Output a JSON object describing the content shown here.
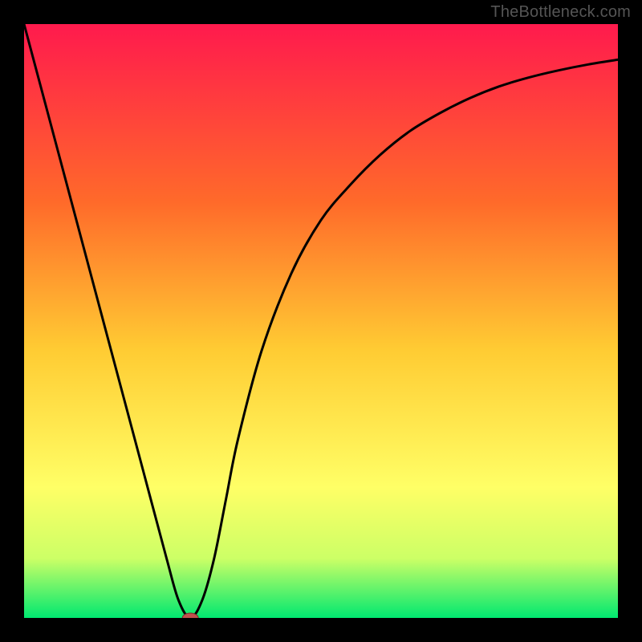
{
  "watermark": "TheBottleneck.com",
  "chart_data": {
    "type": "line",
    "title": "",
    "xlabel": "",
    "ylabel": "",
    "xlim": [
      0,
      100
    ],
    "ylim": [
      0,
      100
    ],
    "grid": false,
    "legend": false,
    "background_gradient": {
      "stops": [
        {
          "offset": 0,
          "color": "#ff1a4d"
        },
        {
          "offset": 30,
          "color": "#ff6a2a"
        },
        {
          "offset": 55,
          "color": "#ffcc33"
        },
        {
          "offset": 78,
          "color": "#ffff66"
        },
        {
          "offset": 90,
          "color": "#ccff66"
        },
        {
          "offset": 100,
          "color": "#00e870"
        }
      ]
    },
    "series": [
      {
        "name": "bottleneck-curve",
        "x": [
          0,
          4,
          8,
          12,
          16,
          20,
          24,
          26,
          28,
          30,
          32,
          34,
          36,
          40,
          45,
          50,
          55,
          60,
          65,
          70,
          75,
          80,
          85,
          90,
          95,
          100
        ],
        "y": [
          100,
          85,
          70,
          55,
          40,
          25,
          10,
          3,
          0,
          3,
          10,
          20,
          30,
          45,
          58,
          67,
          73,
          78,
          82,
          85,
          87.5,
          89.5,
          91,
          92.2,
          93.2,
          94
        ]
      }
    ],
    "markers": [
      {
        "name": "minimum-marker",
        "x": 28,
        "y": 0,
        "color": "#c0504d",
        "rx": 10,
        "ry": 6
      }
    ]
  }
}
